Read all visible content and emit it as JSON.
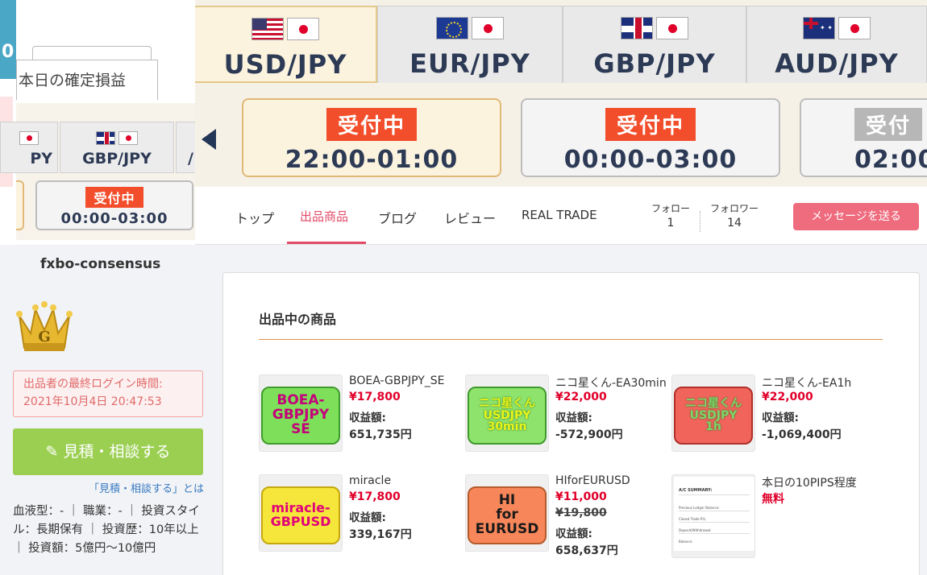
{
  "banner": {
    "pairs": [
      {
        "label": "USD/JPY",
        "flag": "us-flag-icon"
      },
      {
        "label": "EUR/JPY",
        "flag": "eu-flag-icon"
      },
      {
        "label": "GBP/JPY",
        "flag": "uk-flag-icon"
      },
      {
        "label": "AUD/JPY",
        "flag": "au-flag-icon"
      }
    ],
    "slots": [
      {
        "badge": "受付中",
        "time": "22:00-01:00"
      },
      {
        "badge": "受付中",
        "time": "00:00-03:00"
      },
      {
        "badge": "受付",
        "time": "02:00"
      }
    ],
    "colors": {
      "badge_red": "#f24e2b",
      "pair_text": "#2d3a55"
    }
  },
  "mini_banner": {
    "bluebar_text": "0",
    "tab_label": "本日の確定損益",
    "pairs": [
      {
        "label": "PY"
      },
      {
        "label": "GBP/JPY"
      },
      {
        "label": "/"
      }
    ],
    "slot": {
      "badge": "受付中",
      "time": "00:00-03:00"
    }
  },
  "nav": {
    "items": [
      "トップ",
      "出品商品",
      "ブログ",
      "レビュー",
      "REAL TRADE"
    ],
    "active_index": 1,
    "follow": {
      "label": "フォロー",
      "count": "1"
    },
    "followers": {
      "label": "フォロワー",
      "count": "14"
    },
    "message_button": "メッセージを送る",
    "accent": "#e24a67"
  },
  "sidebar": {
    "username": "fxbo-consensus",
    "rank_letter": "G",
    "last_login_label": "出品者の最終ログイン時間:",
    "last_login_value": "2021年10月4日 20:47:53",
    "consult_button": "見積・相談する",
    "consult_link": "「見積・相談する」とは",
    "profile": "血液型：- ｜ 職業：- ｜ 投資スタイル：長期保有 ｜ 投資歴：10年以上 ｜ 投資額：5億円〜10億円"
  },
  "main": {
    "section_title": "出品中の商品",
    "products": [
      {
        "title": "BOEA-GBPJPY_SE",
        "price": "¥17,800",
        "profit_label": "収益額:",
        "profit": "651,735円",
        "thumb_text": "BOEA-\nGBPJPY\nSE",
        "thumb_bg": "#7ee05a",
        "thumb_fg": "#c4007a"
      },
      {
        "title": "ニコ星くん-EA30min",
        "price": "¥22,000",
        "profit_label": "収益額:",
        "profit": "-572,900円",
        "thumb_text": "ニコ星くん\nUSDJPY\n30min",
        "thumb_bg": "#8ee36d",
        "thumb_fg": "#e9f51a"
      },
      {
        "title": "ニコ星くん-EA1h",
        "price": "¥22,000",
        "profit_label": "収益額:",
        "profit": "-1,069,400円",
        "thumb_text": "ニコ星くん\nUSDJPY\n1h",
        "thumb_bg": "#f0645c",
        "thumb_fg": "#7ed66a"
      },
      {
        "title": "miracle",
        "price": "¥17,800",
        "profit_label": "収益額:",
        "profit": "339,167円",
        "thumb_text": "miracle-\nGBPUSD",
        "thumb_bg": "#f6e53a",
        "thumb_fg": "#e0007a"
      },
      {
        "title": "HIforEURUSD",
        "price": "¥11,000",
        "original_price": "¥19,800",
        "profit_label": "収益額:",
        "profit": "658,637円",
        "thumb_text": "HI\nfor\nEURUSD",
        "thumb_bg": "#f7875a",
        "thumb_fg": "#1a1a1a"
      },
      {
        "title": "本日の10PIPS程度",
        "price": "無料",
        "thumb_text": "A/C SUMMARY:"
      }
    ],
    "report_lines": [
      "Previous Ledger Balance:",
      "Closed Trade P/L:",
      "Deposit/Withdrawal:",
      "Balance:"
    ]
  }
}
